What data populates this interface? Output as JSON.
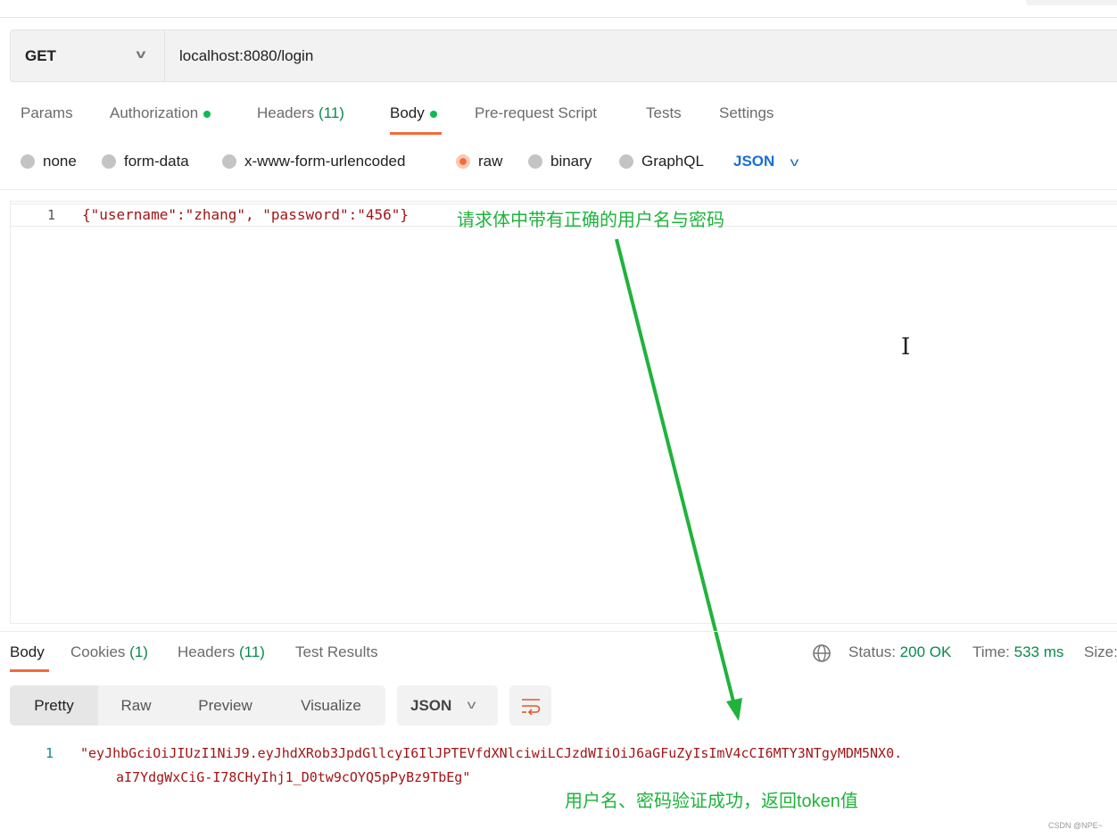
{
  "request": {
    "method": "GET",
    "url": "localhost:8080/login"
  },
  "tabs": [
    {
      "label": "Params"
    },
    {
      "label": "Authorization"
    },
    {
      "label": "Headers",
      "count": "(11)"
    },
    {
      "label": "Body"
    },
    {
      "label": "Pre-request Script"
    },
    {
      "label": "Tests"
    },
    {
      "label": "Settings"
    }
  ],
  "body_types": [
    "none",
    "form-data",
    "x-www-form-urlencoded",
    "raw",
    "binary",
    "GraphQL"
  ],
  "selected_body_type": "raw",
  "format": "JSON",
  "editor": {
    "line_number": "1",
    "content": "{\"username\":\"zhang\", \"password\":\"456\"}"
  },
  "annotations": {
    "request": "请求体中带有正确的用户名与密码",
    "response": "用户名、密码验证成功，返回token值"
  },
  "response": {
    "tabs": [
      {
        "label": "Body"
      },
      {
        "label": "Cookies",
        "count": "(1)"
      },
      {
        "label": "Headers",
        "count": "(11)"
      },
      {
        "label": "Test Results"
      }
    ],
    "status_label": "Status:",
    "status": "200 OK",
    "time_label": "Time:",
    "time": "533 ms",
    "size_label": "Size:",
    "views": [
      "Pretty",
      "Raw",
      "Preview",
      "Visualize"
    ],
    "format": "JSON",
    "line_number": "1",
    "line1": "\"eyJhbGciOiJIUzI1NiJ9.eyJhdXRob3JpdGllcyI6IlJPTEVfdXNlciwiLCJzdWIiOiJ6aGFuZyIsImV4cCI6MTY3NTgyMDM5NX0.",
    "line2": "aI7YdgWxCiG-I78CHyIhj1_D0tw9cOYQ5pPyBz9TbEg\""
  },
  "watermark": "CSDN @NPE~",
  "colors": {
    "accent": "#f26b3a",
    "success": "#0b8a4d",
    "annotation": "#1fb33c",
    "link": "#1a6fd1"
  }
}
